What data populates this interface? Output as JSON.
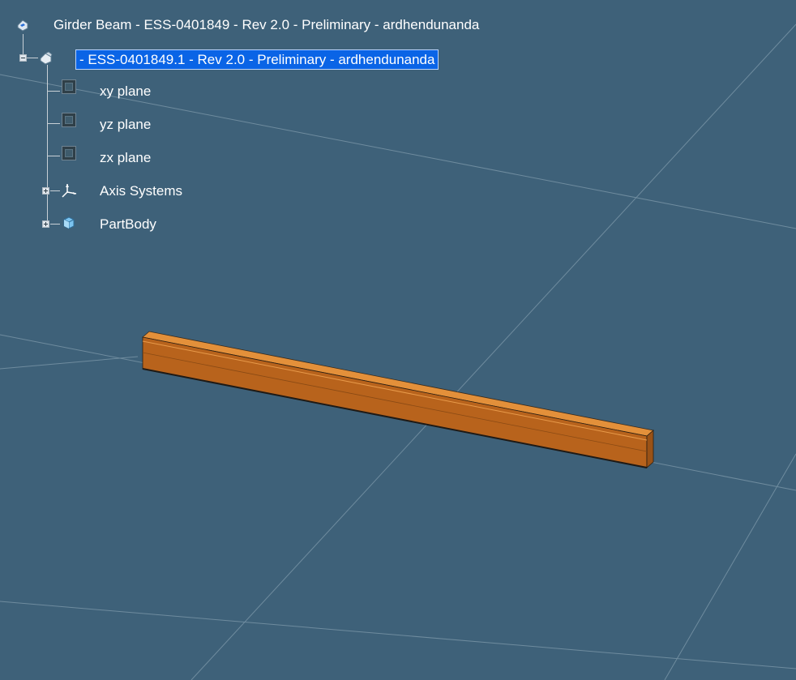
{
  "tree": {
    "root_label": "Girder Beam  -  ESS-0401849  -  Rev  2.0  -  Preliminary  -  ardhendunanda",
    "part_label": "-  ESS-0401849.1  -  Rev  2.0  -  Preliminary  -  ardhendunanda",
    "items": [
      {
        "label": "xy plane",
        "icon": "plane-icon"
      },
      {
        "label": "yz plane",
        "icon": "plane-icon"
      },
      {
        "label": "zx plane",
        "icon": "plane-icon"
      },
      {
        "label": "Axis Systems",
        "icon": "axis-system-icon"
      },
      {
        "label": "PartBody",
        "icon": "part-body-icon"
      }
    ]
  },
  "colors": {
    "background": "#3e6179",
    "grid_line": "#7f9aab",
    "beam_top": "#e08a32",
    "beam_front": "#b9621a",
    "beam_end": "#c97328",
    "selection": "#0a64e6"
  }
}
